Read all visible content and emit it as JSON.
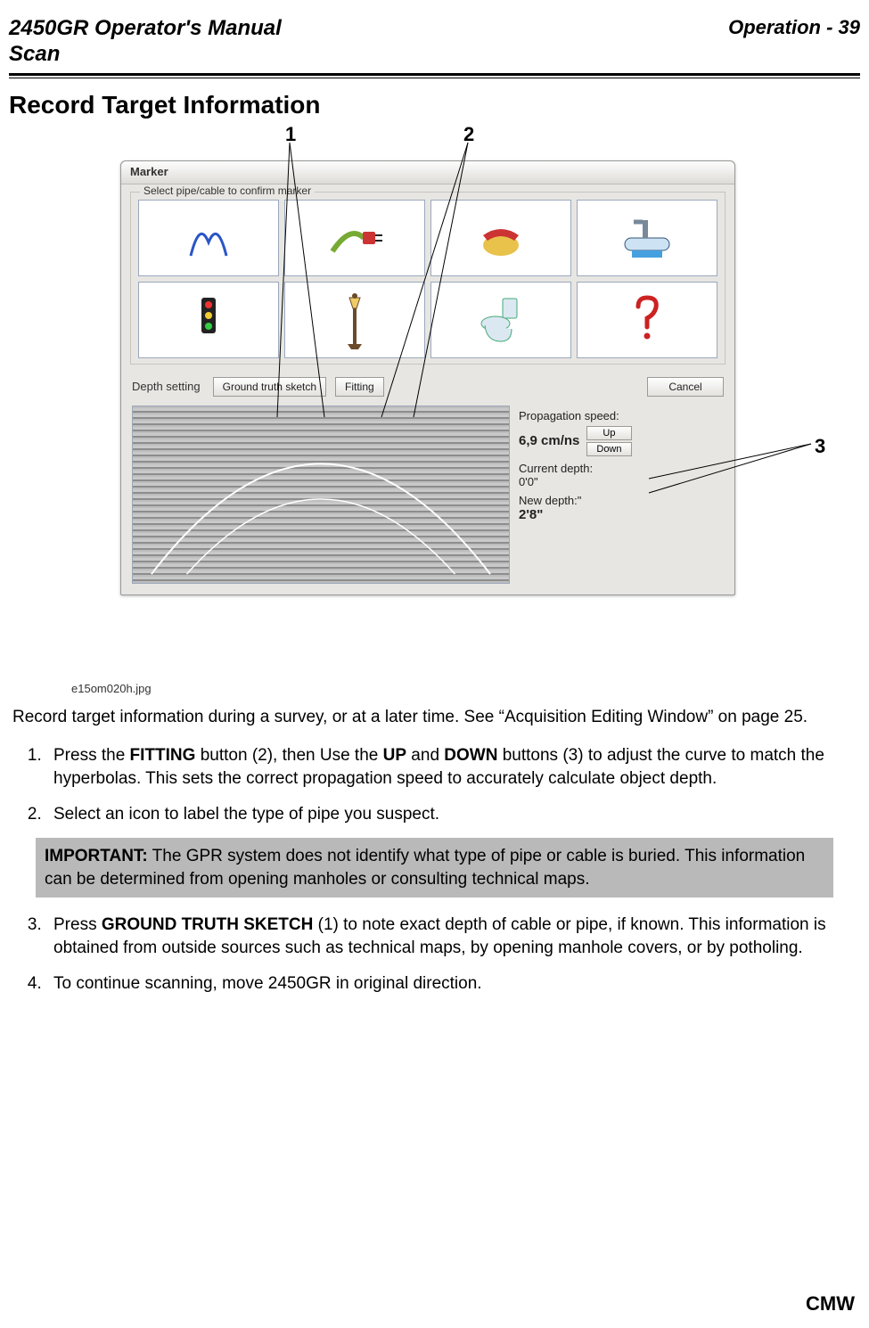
{
  "header": {
    "manual_title": "2450GR Operator's Manual",
    "section": "Scan",
    "page_ref": "Operation - 39"
  },
  "section_title": "Record Target Information",
  "callouts": {
    "one": "1",
    "two": "2",
    "three": "3"
  },
  "window": {
    "title": "Marker",
    "group_label": "Select pipe/cable to confirm marker",
    "icons": {
      "gas": "gas-flame-icon",
      "electric": "electric-plug-icon",
      "telecom": "telephone-icon",
      "water": "sink-icon",
      "traffic": "traffic-light-icon",
      "lamp": "street-lamp-icon",
      "sewer": "toilet-icon",
      "unknown": "question-mark-icon"
    },
    "depth_label": "Depth setting",
    "buttons": {
      "ground_truth": "Ground truth sketch",
      "fitting": "Fitting",
      "cancel": "Cancel",
      "up": "Up",
      "down": "Down"
    },
    "side": {
      "prop_label": "Propagation speed:",
      "prop_value": "6,9 cm/ns",
      "cur_depth_label": "Current depth:",
      "cur_depth_value": "0'0\"",
      "new_depth_label": "New depth:\"",
      "new_depth_value": "2'8\""
    }
  },
  "image_caption": "e15om020h.jpg",
  "intro": "Record target information during a survey, or at a later time. See “Acquisition Editing Window” on page 25.",
  "steps": {
    "s1_a": "Press the ",
    "s1_b_bold": "FITTING",
    "s1_c": " button (2), then Use the ",
    "s1_d_bold": "UP",
    "s1_e": " and ",
    "s1_f_bold": "DOWN",
    "s1_g": " buttons (3) to adjust the curve to match the hyperbolas. This sets the correct propagation speed to accurately calculate object depth.",
    "s2": "Select an icon to label the type of pipe you suspect.",
    "s3_a": "Press ",
    "s3_b_bold": "GROUND TRUTH SKETCH",
    "s3_c": " (1) to note exact depth of cable or pipe, if known. This information is obtained from outside sources such as technical maps, by opening manhole covers, or by potholing.",
    "s4": "To continue scanning, move 2450GR in original direction."
  },
  "important": {
    "label": "IMPORTANT:",
    "text": " The GPR system does not identify what type of pipe or cable is buried. This information can be determined from opening manholes or consulting technical maps."
  },
  "footer": "CMW"
}
